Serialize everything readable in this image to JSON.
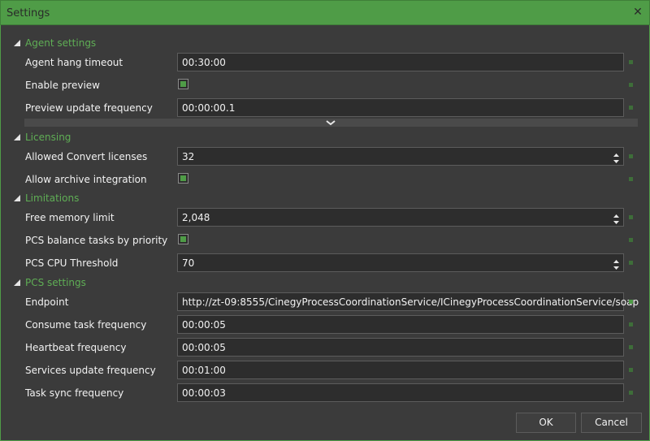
{
  "window": {
    "title": "Settings"
  },
  "sections": [
    {
      "label": "Agent settings"
    },
    {
      "label": "Licensing"
    },
    {
      "label": "Limitations"
    },
    {
      "label": "PCS settings"
    }
  ],
  "rows": {
    "agent_hang_timeout": {
      "label": "Agent hang timeout",
      "value": "00:30:00"
    },
    "enable_preview": {
      "label": "Enable preview",
      "checked": true
    },
    "preview_update_frequency": {
      "label": "Preview update frequency",
      "value": "00:00:00.1"
    },
    "allowed_convert_licenses": {
      "label": "Allowed Convert licenses",
      "value": "32"
    },
    "allow_archive_integration": {
      "label": "Allow archive integration",
      "checked": true
    },
    "free_memory_limit": {
      "label": "Free memory limit",
      "value": "2,048"
    },
    "pcs_balance_tasks": {
      "label": "PCS balance tasks by priority",
      "checked": true
    },
    "pcs_cpu_threshold": {
      "label": "PCS CPU Threshold",
      "value": "70"
    },
    "endpoint": {
      "label": "Endpoint",
      "value": "http://zt-09:8555/CinegyProcessCoordinationService/ICinegyProcessCoordinationService/soap"
    },
    "consume_task_frequency": {
      "label": "Consume task frequency",
      "value": "00:00:05"
    },
    "heartbeat_frequency": {
      "label": "Heartbeat frequency",
      "value": "00:00:05"
    },
    "services_update_frequency": {
      "label": "Services update frequency",
      "value": "00:01:00"
    },
    "task_sync_frequency": {
      "label": "Task sync frequency",
      "value": "00:00:03"
    }
  },
  "buttons": {
    "ok": "OK",
    "cancel": "Cancel"
  },
  "colors": {
    "accent": "#4f9c47",
    "section_text": "#5fae55",
    "background": "#3b3b3b",
    "field_bg": "#2d2d2d"
  }
}
